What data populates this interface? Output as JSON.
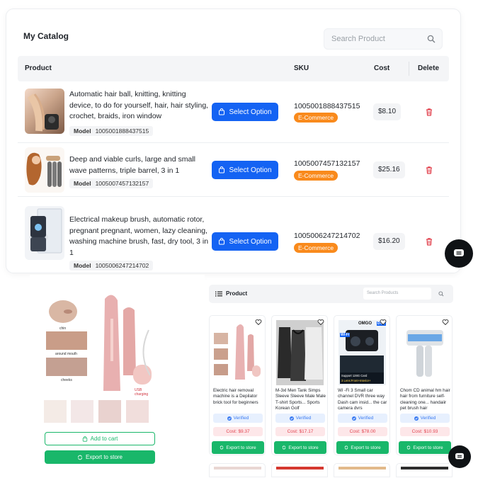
{
  "catalog": {
    "title": "My Catalog",
    "search_placeholder": "Search Product",
    "columns": {
      "product": "Product",
      "sku": "SKU",
      "cost": "Cost",
      "delete": "Delete"
    },
    "rows": [
      {
        "name": "Automatic hair ball, knitting, knitting device, to do for yourself, hair, hair styling, crochet, braids, iron window",
        "model_label": "Model",
        "model": "1005001888437515",
        "button": "Select Option",
        "sku": "1005001888437515",
        "tag": "E-Commerce",
        "cost": "$8.10"
      },
      {
        "name": "Deep and viable curls, large and small wave patterns, triple barrel, 3 in 1",
        "model_label": "Model",
        "model": "1005007457132157",
        "button": "Select Option",
        "sku": "1005007457132157",
        "tag": "E-Commerce",
        "cost": "$25.16"
      },
      {
        "name": "Electrical makeup brush, automatic rotor, pregnant pregnant, women, lazy cleaning, washing machine brush, fast, dry tool, 3 in 1",
        "model_label": "Model",
        "model": "1005006247214702",
        "button": "Select Option",
        "sku": "1005006247214702",
        "tag": "E-Commerce",
        "cost": "$16.20"
      }
    ]
  },
  "detail": {
    "labels": {
      "chin": "chin",
      "around_mouth": "around mouth",
      "cheeks": "cheeks",
      "usb": "USB charging"
    },
    "add_to_cart": "Add to cart",
    "export": "Export to store"
  },
  "grid": {
    "title": "Product",
    "search_placeholder": "Search Products",
    "cards": [
      {
        "name": "Electric hair removal machine is a Depilator brick tool for beginners",
        "verified": "Verified",
        "cost": "Cost: $9.37",
        "export": "Export to store"
      },
      {
        "name": "M-3xl Men Tank Simps Sleeve Sleeve Male Male T-shirt Sports... Sports Korean Golf",
        "verified": "Verified",
        "cost": "Cost: $17.17",
        "export": "Export to store"
      },
      {
        "name": "Wi -Fi 3 Small car channel DVR three way Dash cam insid... the car camera dvrs",
        "verified": "Verified",
        "cost": "Cost: $78.00",
        "export": "Export to store",
        "img_text": {
          "brand": "OMGO",
          "wifi": "Wi-Fi",
          "dvr": "DVR",
          "support": "Support 128G Card",
          "lens": "3 Lens:Front+Interior+"
        }
      },
      {
        "name": "Chom CD animal hm hair hair from furniture self-cleaning one... handaiir pet brush hair",
        "verified": "Verified",
        "cost": "Cost: $10.93",
        "export": "Export to store"
      }
    ]
  },
  "colors": {
    "primary_blue": "#1463f3",
    "orange_tag": "#f98a1c",
    "green": "#19b76a",
    "delete_red": "#e2434f"
  }
}
